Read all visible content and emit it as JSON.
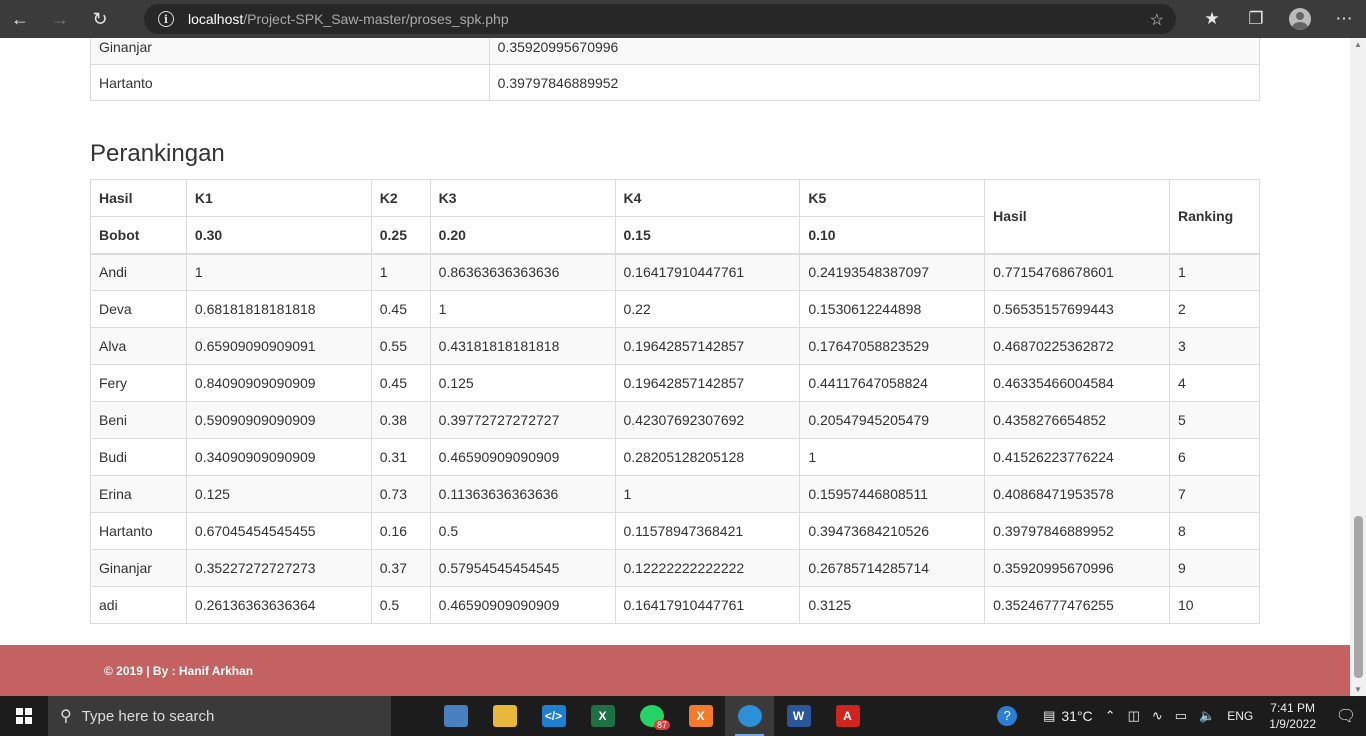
{
  "browser": {
    "url_host": "localhost",
    "url_path": "/Project-SPK_Saw-master/proses_spk.php"
  },
  "top_table": {
    "rows": [
      {
        "name": "Ginanjar",
        "value": "0.35920995670996"
      },
      {
        "name": "Hartanto",
        "value": "0.39797846889952"
      }
    ]
  },
  "ranking": {
    "title": "Perankingan",
    "header": {
      "col0": "Hasil",
      "k1": "K1",
      "k2": "K2",
      "k3": "K3",
      "k4": "K4",
      "k5": "K5",
      "hasil": "Hasil",
      "ranking": "Ranking"
    },
    "bobot": {
      "label": "Bobot",
      "k1": "0.30",
      "k2": "0.25",
      "k3": "0.20",
      "k4": "0.15",
      "k5": "0.10"
    },
    "rows": [
      {
        "name": "Andi",
        "k1": "1",
        "k2": "1",
        "k3": "0.86363636363636",
        "k4": "0.16417910447761",
        "k5": "0.24193548387097",
        "hasil": "0.77154768678601",
        "rank": "1"
      },
      {
        "name": "Deva",
        "k1": "0.68181818181818",
        "k2": "0.45",
        "k3": "1",
        "k4": "0.22",
        "k5": "0.1530612244898",
        "hasil": "0.56535157699443",
        "rank": "2"
      },
      {
        "name": "Alva",
        "k1": "0.65909090909091",
        "k2": "0.55",
        "k3": "0.43181818181818",
        "k4": "0.19642857142857",
        "k5": "0.17647058823529",
        "hasil": "0.46870225362872",
        "rank": "3"
      },
      {
        "name": "Fery",
        "k1": "0.84090909090909",
        "k2": "0.45",
        "k3": "0.125",
        "k4": "0.19642857142857",
        "k5": "0.44117647058824",
        "hasil": "0.46335466004584",
        "rank": "4"
      },
      {
        "name": "Beni",
        "k1": "0.59090909090909",
        "k2": "0.38",
        "k3": "0.39772727272727",
        "k4": "0.42307692307692",
        "k5": "0.20547945205479",
        "hasil": "0.4358276654852",
        "rank": "5"
      },
      {
        "name": "Budi",
        "k1": "0.34090909090909",
        "k2": "0.31",
        "k3": "0.46590909090909",
        "k4": "0.28205128205128",
        "k5": "1",
        "hasil": "0.41526223776224",
        "rank": "6"
      },
      {
        "name": "Erina",
        "k1": "0.125",
        "k2": "0.73",
        "k3": "0.11363636363636",
        "k4": "1",
        "k5": "0.15957446808511",
        "hasil": "0.40868471953578",
        "rank": "7"
      },
      {
        "name": "Hartanto",
        "k1": "0.67045454545455",
        "k2": "0.16",
        "k3": "0.5",
        "k4": "0.11578947368421",
        "k5": "0.39473684210526",
        "hasil": "0.39797846889952",
        "rank": "8"
      },
      {
        "name": "Ginanjar",
        "k1": "0.35227272727273",
        "k2": "0.37",
        "k3": "0.57954545454545",
        "k4": "0.12222222222222",
        "k5": "0.26785714285714",
        "hasil": "0.35920995670996",
        "rank": "9"
      },
      {
        "name": "adi",
        "k1": "0.26136363636364",
        "k2": "0.5",
        "k3": "0.46590909090909",
        "k4": "0.16417910447761",
        "k5": "0.3125",
        "hasil": "0.35246777476255",
        "rank": "10"
      }
    ]
  },
  "footer": {
    "text": "© 2019 | By : Hanif Arkhan"
  },
  "taskbar": {
    "search_placeholder": "Type here to search",
    "whatsapp_badge": "87",
    "temperature": "31°C",
    "language": "ENG",
    "time": "7:41 PM",
    "date": "1/9/2022"
  }
}
